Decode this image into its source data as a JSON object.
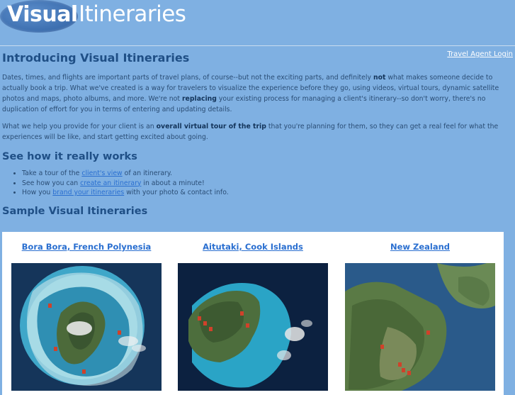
{
  "logo": {
    "part1": "Visual",
    "part2": "Itineraries"
  },
  "header": {
    "login_label": "Travel Agent Login"
  },
  "intro": {
    "title": "Introducing Visual Itineraries",
    "p1_a": "Dates, times, and flights are important parts of travel plans, of course--but not the exciting parts, and definitely ",
    "p1_b": "not",
    "p1_c": " what makes someone decide to actually book a trip. What we've created is a way for travelers to visualize the experience before they go, using videos, virtual tours, dynamic satellite photos and maps, photo albums, and more. We're not ",
    "p1_d": "replacing",
    "p1_e": " your existing process for managing a client's itinerary--so don't worry, there's no duplication of effort for you in terms of entering and updating details.",
    "p2_a": "What we help you provide for your client is an ",
    "p2_b": "overall virtual tour of the trip",
    "p2_c": " that you're planning for them, so they can get a real feel for what the experiences will be like, and start getting excited about going."
  },
  "how": {
    "title": "See how it really works",
    "items": [
      {
        "pre": "Take a tour of the ",
        "link": "client's view",
        "post": " of an itinerary."
      },
      {
        "pre": "See how you can ",
        "link": "create an itinerary",
        "post": " in about a minute!"
      },
      {
        "pre": "How you ",
        "link": "brand your itineraries",
        "post": " with your photo & contact info."
      }
    ]
  },
  "samples": {
    "title": "Sample Visual Itineraries",
    "items": [
      {
        "title": "Bora Bora, French Polynesia"
      },
      {
        "title": "Aitutaki, Cook Islands"
      },
      {
        "title": "New Zealand"
      }
    ]
  },
  "colors": {
    "background": "#7fb0e2",
    "heading": "#1f4f86",
    "link": "#2a6fd0",
    "panel": "#ffffff"
  },
  "icons": {
    "map_marker": "map-marker-icon"
  }
}
